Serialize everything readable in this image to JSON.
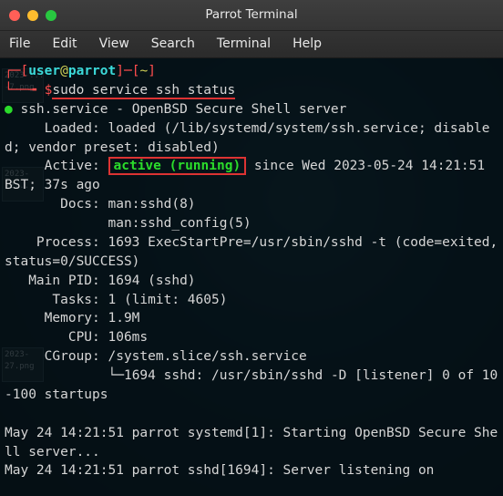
{
  "window": {
    "title": "Parrot Terminal"
  },
  "menu": {
    "file": "File",
    "edit": "Edit",
    "view": "View",
    "search": "Search",
    "terminal": "Terminal",
    "help": "Help"
  },
  "desktop": {
    "icon1": "2023-...\n-7.png",
    "icon2": "2023-  \n-2...",
    "icon3": "2023- \n27.png"
  },
  "prompt": {
    "open": "┌─[",
    "user": "user",
    "at": "@",
    "host": "parrot",
    "sep1": "]─[",
    "path": "~",
    "close": "]",
    "line2_prefix": "└──╼ ",
    "dollar": "$"
  },
  "command": "sudo service ssh status",
  "output": {
    "bullet": "●",
    "svc_head_left": " ssh.service - ",
    "svc_head_right": "OpenBSD Secure Shell server",
    "loaded": "     Loaded: loaded (/lib/systemd/system/ssh.service; disabled; vendor preset: disabled)",
    "active_label": "     Active: ",
    "active_value": "active (running)",
    "active_since": " since Wed 2023-05-24 14:21:51 BST; 37s ago",
    "docs_label": "       Docs: ",
    "docs1": "man:sshd(8)",
    "docs2_pad": "             ",
    "docs2": "man:sshd_config(5)",
    "process": "    Process: 1693 ExecStartPre=/usr/sbin/sshd -t (code=exited, status=0/SUCCESS)",
    "mainpid": "   Main PID: 1694 (sshd)",
    "tasks": "      Tasks: 1 (limit: 4605)",
    "memory": "     Memory: 1.9M",
    "cpu": "        CPU: 106ms",
    "cgroup": "     CGroup: /system.slice/ssh.service",
    "tree_line": "             └─",
    "tree_proc": "1694 sshd: /usr/sbin/sshd -D [listener] 0 of 10-100 startups",
    "blank": " ",
    "log1": "May 24 14:21:51 parrot systemd[1]: Starting OpenBSD Secure Shell server...",
    "log2": "May 24 14:21:51 parrot sshd[1694]: Server listening on"
  },
  "colors": {
    "prompt_red": "#ff4d4d",
    "prompt_cyan": "#3cdada",
    "prompt_yellow": "#cfcf55",
    "active_green": "#2bdc2b",
    "annotation_red": "#d33"
  }
}
